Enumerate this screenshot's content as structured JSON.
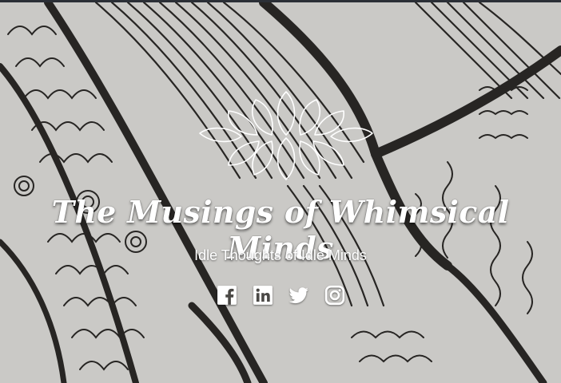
{
  "site": {
    "title": "The Musings of Whimsical Minds",
    "tagline": "Idle Thoughts of Idle Minds"
  },
  "header": {
    "logo_icon": "leaf-cluster-icon",
    "background": "black-ink-doodle-art-photo"
  },
  "social": [
    {
      "name": "facebook",
      "icon": "facebook-icon"
    },
    {
      "name": "linkedin",
      "icon": "linkedin-icon"
    },
    {
      "name": "twitter",
      "icon": "twitter-icon"
    },
    {
      "name": "instagram",
      "icon": "instagram-icon"
    }
  ],
  "colors": {
    "topbar": "#2b2f36",
    "text": "#ffffff",
    "paper": "#d9d8d5",
    "ink": "#2a2826"
  }
}
